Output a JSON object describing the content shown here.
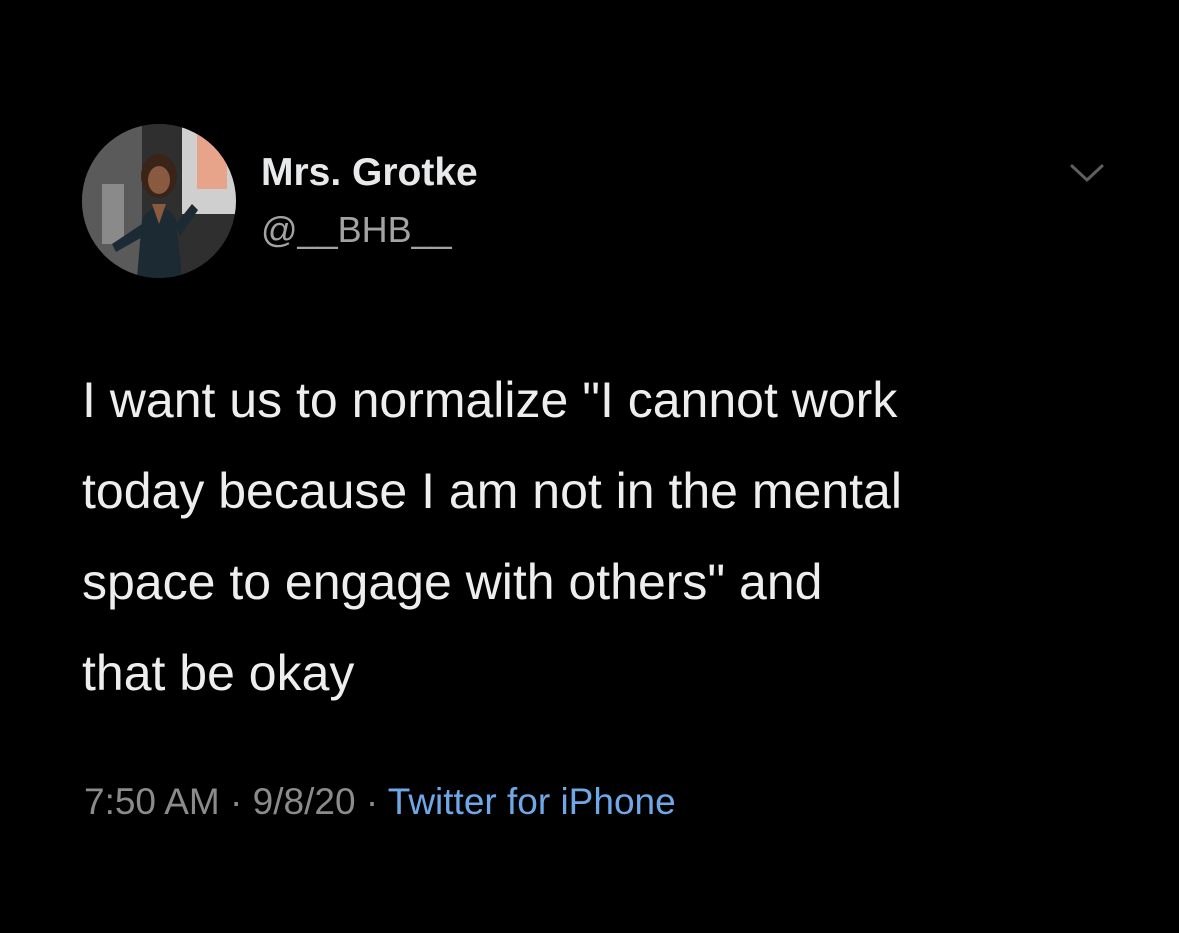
{
  "author": {
    "display_name": "Mrs. Grotke",
    "handle": "@__BHB__"
  },
  "tweet": {
    "lines": [
      "I want us to normalize \"I cannot work",
      "today because I am not in the mental",
      "space to engage with others\" and",
      "that be okay"
    ]
  },
  "meta": {
    "time": "7:50 AM",
    "separator1": "·",
    "date": "9/8/20",
    "separator2": "·",
    "source": "Twitter for iPhone"
  },
  "icons": {
    "menu": "chevron-down-icon"
  },
  "colors": {
    "background": "#000000",
    "text": "#eeeeee",
    "secondary": "#8b8b8b",
    "link": "#6fa8e8"
  }
}
